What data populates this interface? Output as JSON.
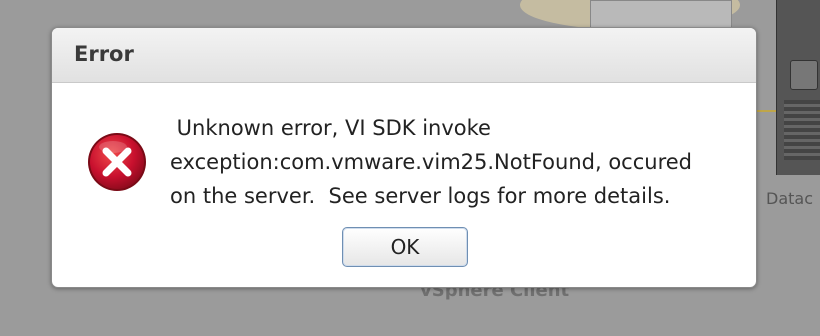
{
  "background": {
    "datacenter_label": "Datac",
    "client_label": "vSphere Client"
  },
  "dialog": {
    "title": "Error",
    "icon": "error-x-icon",
    "message_lines": [
      " Unknown error, VI SDK invoke",
      "exception:com.vmware.vim25.NotFound, occured",
      "on the server.  See server logs for more details."
    ],
    "ok_label": "OK"
  },
  "colors": {
    "icon_red": "#c8102e",
    "button_border": "#6f8fb3"
  }
}
